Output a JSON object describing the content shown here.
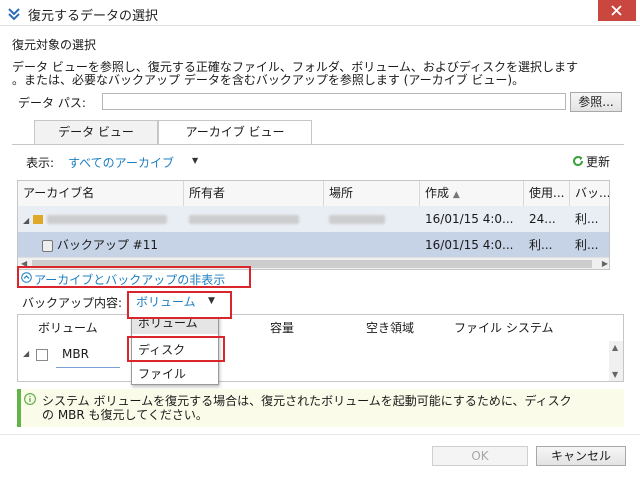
{
  "window": {
    "title": "復元するデータの選択",
    "app_icon": "arrow-icon",
    "close_icon": "close-icon"
  },
  "section_title": "復元対象の選択",
  "description": {
    "line1": "データ ビューを参照し、復元する正確なファイル、フォルダ、ボリューム、およびディスクを選択します",
    "line2": "。または、必要なバックアップ データを含むバックアップを参照します (アーカイブ ビュー)。"
  },
  "data_path": {
    "label": "データ パス:",
    "value": "",
    "browse_label": "参照..."
  },
  "tabs": [
    {
      "label": "データ ビュー",
      "selected": false
    },
    {
      "label": "アーカイブ ビュー",
      "selected": true
    }
  ],
  "filter": {
    "show_label": "表示:",
    "value": "すべてのアーカイブ",
    "refresh_label": "更新"
  },
  "archive_table": {
    "headers": [
      "アーカイブ名",
      "所有者",
      "場所",
      "作成",
      "使用...",
      "バッ..."
    ],
    "rows": [
      {
        "name": "",
        "owner": "",
        "location": "",
        "created": "16/01/15 4:0...",
        "used": "24...",
        "backup": "利..."
      },
      {
        "name": "バックアップ #11",
        "owner": "",
        "location": "",
        "created": "16/01/15 4:0...",
        "used": "利...",
        "backup": "利..."
      }
    ]
  },
  "hide_link": "アーカイブとバックアップの非表示",
  "backup_contents": {
    "label": "バックアップ内容:",
    "selected": "ボリューム",
    "options": [
      "ボリューム",
      "ディスク",
      "ファイル"
    ]
  },
  "volume_table": {
    "headers": [
      "ボリューム",
      "容量",
      "空き領域",
      "ファイル システム"
    ],
    "rows": [
      {
        "name": "MBR"
      }
    ]
  },
  "info": {
    "line1": "システム ボリュームを復元する場合は、復元されたボリュームを起動可能にするために、ディスク",
    "line2": "の MBR も復元してください。"
  },
  "buttons": {
    "ok": "OK",
    "cancel": "キャンセル"
  },
  "colors": {
    "link": "#1d7fc2",
    "highlight": "#d8262c",
    "info_accent": "#62b34a",
    "close": "#c9473e"
  }
}
